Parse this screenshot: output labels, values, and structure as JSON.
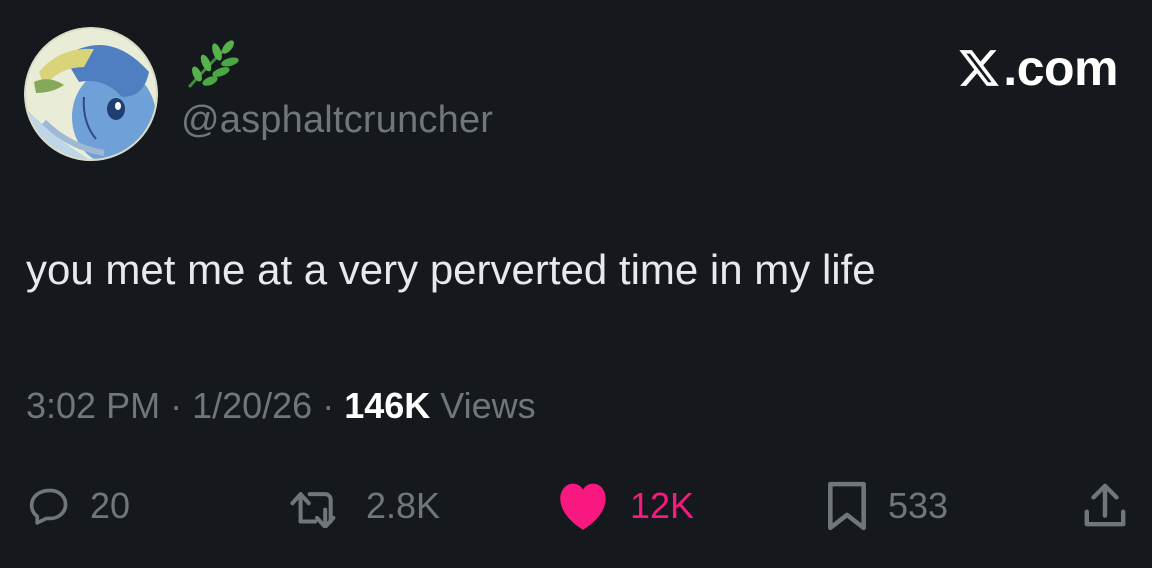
{
  "user": {
    "name_emoji": "🌿",
    "handle": "@asphaltcruncher",
    "avatar": "anime-girl-avatar"
  },
  "brand": {
    "text": "X.com",
    "icon": "x-logo-icon"
  },
  "tweet": {
    "text": "you met me at a very perverted time in my life"
  },
  "meta": {
    "time": "3:02 PM",
    "separator_1": " · ",
    "date": "1/20/26",
    "separator_2": " · ",
    "views_count": "146K",
    "views_label": " Views"
  },
  "actions": {
    "reply": {
      "icon": "reply-icon",
      "count": "20"
    },
    "retweet": {
      "icon": "retweet-icon",
      "count": "2.8K"
    },
    "like": {
      "icon": "heart-icon",
      "count": "12K",
      "active": true
    },
    "bookmark": {
      "icon": "bookmark-icon",
      "count": "533"
    },
    "share": {
      "icon": "share-icon"
    }
  },
  "colors": {
    "background": "#15181c",
    "text": "#e7e9ea",
    "muted": "#71767b",
    "like": "#f91880",
    "emoji_green": "#4caf50"
  }
}
